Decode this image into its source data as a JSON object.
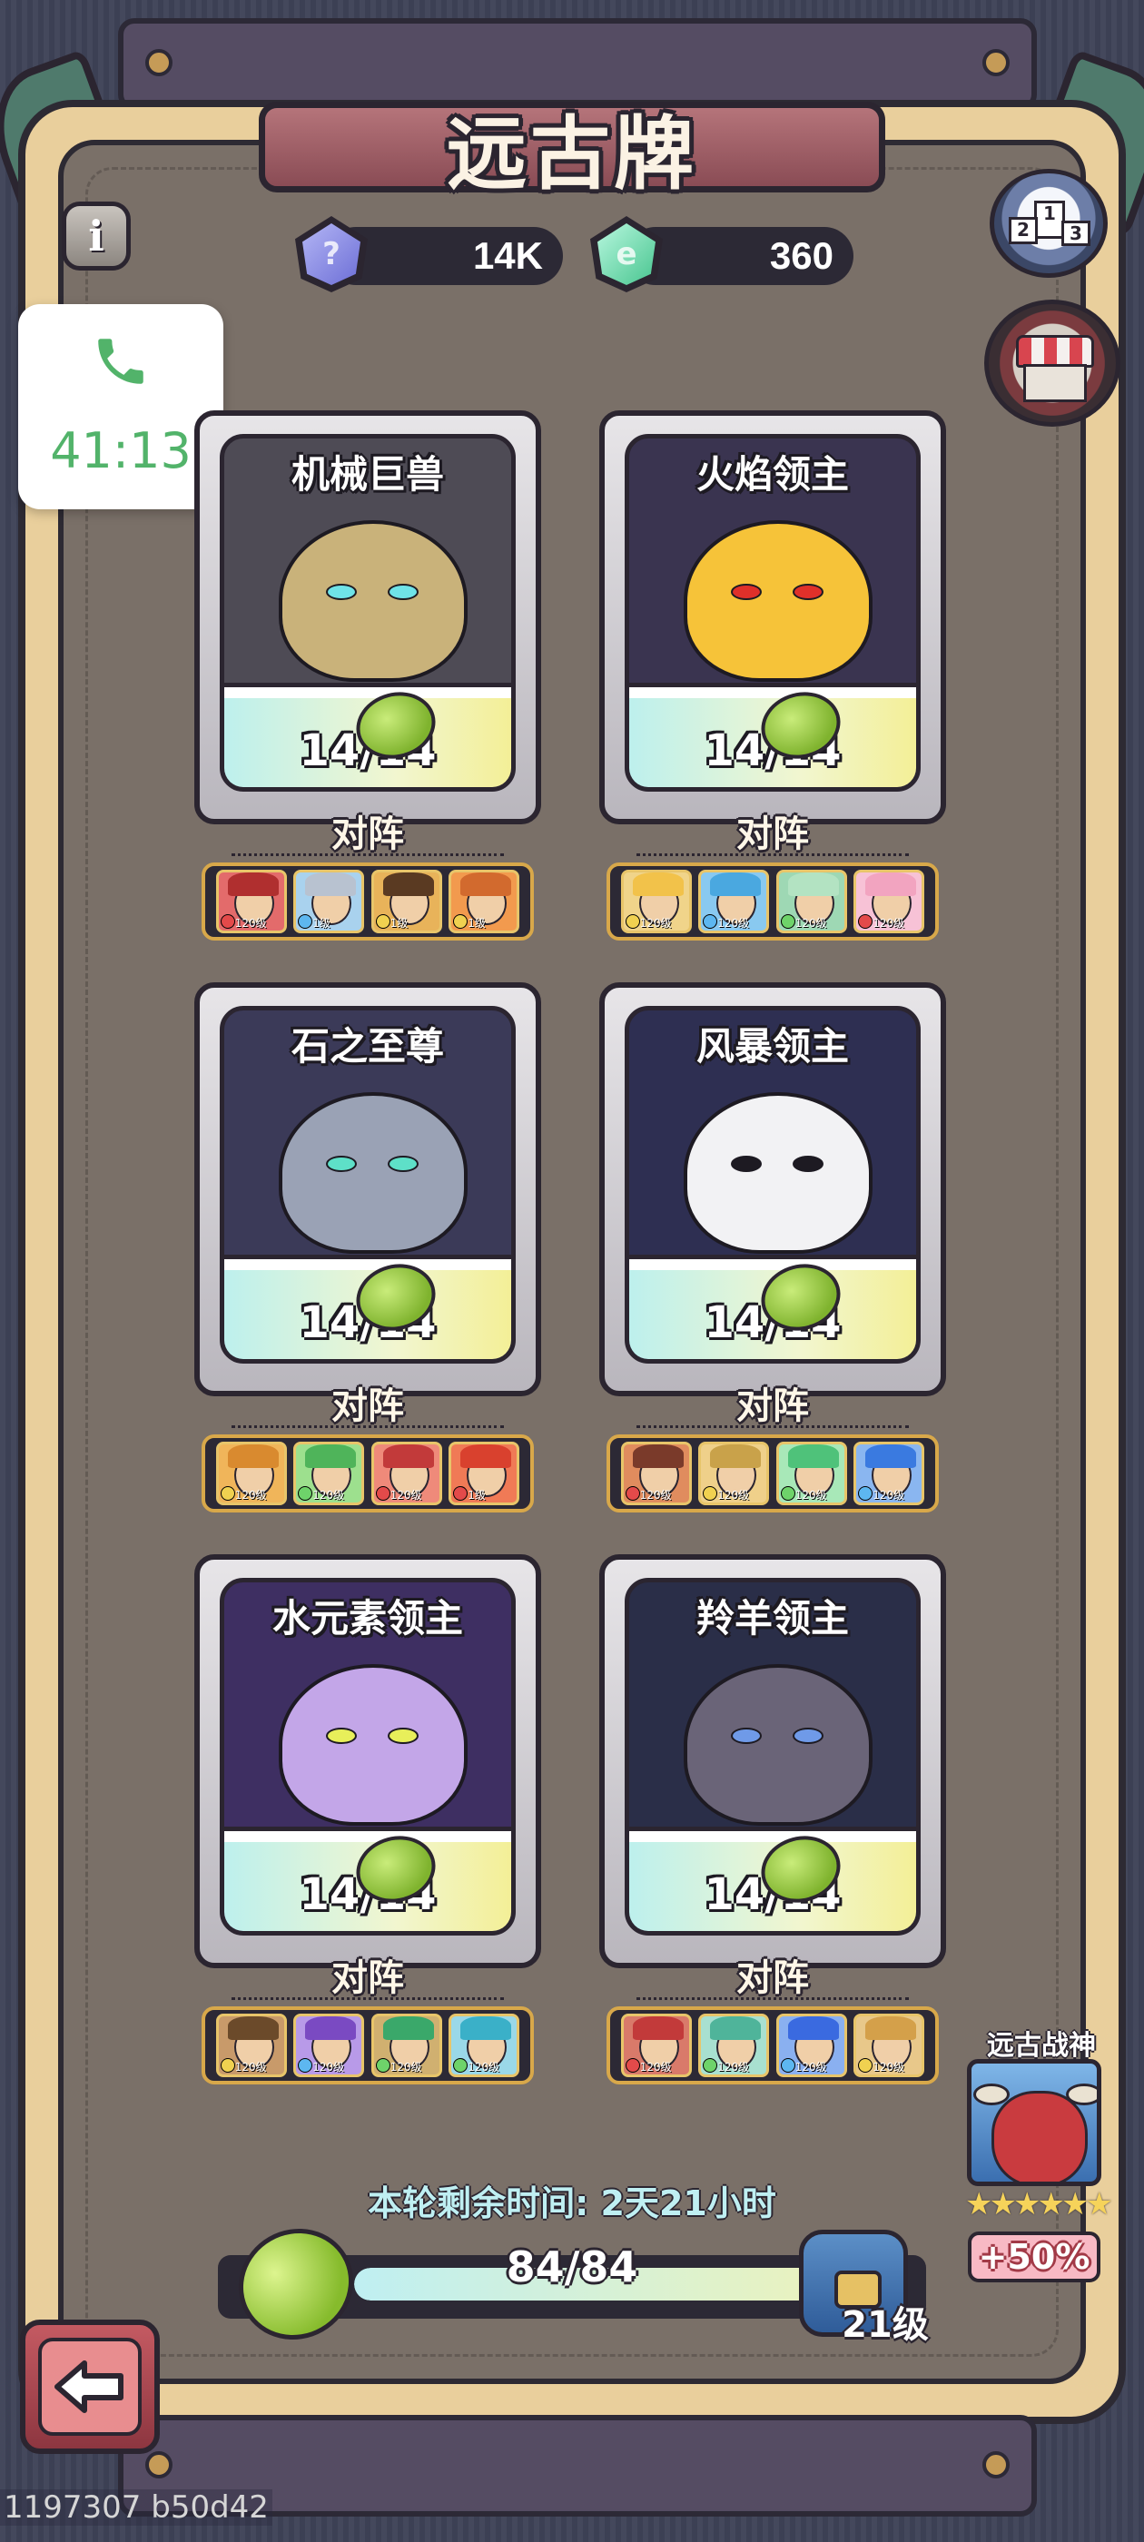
{
  "title": "远古牌",
  "currency": [
    {
      "name": "blue-crystal",
      "value": "14K",
      "color": "#8b8ee0"
    },
    {
      "name": "green-crystal",
      "value": "360",
      "color": "#6fe0b0"
    }
  ],
  "call": {
    "time": "41:13"
  },
  "vs_label": "对阵",
  "cards": [
    {
      "name": "机械巨兽",
      "count": "14/14",
      "bg": "#4e4b55",
      "face": "#c9b27a",
      "eye": "#6fe3e8",
      "team": [
        {
          "hair": "#b02f2f",
          "bg": "#e36b6b",
          "lvl": "120级",
          "el": "#e34a4a"
        },
        {
          "hair": "#b8c2d0",
          "bg": "#a9d2ee",
          "lvl": "1级",
          "el": "#5db7f0"
        },
        {
          "hair": "#5a3a22",
          "bg": "#e8b35a",
          "lvl": "1级",
          "el": "#f0d150"
        },
        {
          "hair": "#d26a2e",
          "bg": "#f29a4e",
          "lvl": "1级",
          "el": "#f0d150"
        }
      ]
    },
    {
      "name": "火焰领主",
      "count": "14/14",
      "bg": "#3a3450",
      "face": "#f6c339",
      "eye": "#e0302a",
      "team": [
        {
          "hair": "#f2c24a",
          "bg": "#f0d48a",
          "lvl": "120级",
          "el": "#f0d150"
        },
        {
          "hair": "#4aa8e0",
          "bg": "#89c9f0",
          "lvl": "120级",
          "el": "#5db7f0"
        },
        {
          "hair": "#b3e3c2",
          "bg": "#9ed8b4",
          "lvl": "120级",
          "el": "#6ed36a"
        },
        {
          "hair": "#f2a4c0",
          "bg": "#f7c2d6",
          "lvl": "120级",
          "el": "#e34a4a"
        }
      ]
    },
    {
      "name": "石之至尊",
      "count": "14/14",
      "bg": "#3b3a58",
      "face": "#9aa2b5",
      "eye": "#5ee0c8",
      "team": [
        {
          "hair": "#d98a2f",
          "bg": "#f0b55a",
          "lvl": "120级",
          "el": "#f0d150"
        },
        {
          "hair": "#4fb45a",
          "bg": "#9de08e",
          "lvl": "120级",
          "el": "#6ed36a"
        },
        {
          "hair": "#c23a3a",
          "bg": "#ef8a7a",
          "lvl": "120级",
          "el": "#e34a4a"
        },
        {
          "hair": "#d9412e",
          "bg": "#f07a56",
          "lvl": "1级",
          "el": "#e34a4a"
        }
      ]
    },
    {
      "name": "风暴领主",
      "count": "14/14",
      "bg": "#2e2f52",
      "face": "#f2f2f4",
      "eye": "#1d1a22",
      "team": [
        {
          "hair": "#7a3a2a",
          "bg": "#e08c5e",
          "lvl": "120级",
          "el": "#e34a4a"
        },
        {
          "hair": "#c9a24a",
          "bg": "#efd08a",
          "lvl": "120级",
          "el": "#f0d150"
        },
        {
          "hair": "#4fc27a",
          "bg": "#a8e8b8",
          "lvl": "120级",
          "el": "#6ed36a"
        },
        {
          "hair": "#3a7ae0",
          "bg": "#8ab6f0",
          "lvl": "120级",
          "el": "#5db7f0"
        }
      ]
    },
    {
      "name": "水元素领主",
      "count": "14/14",
      "bg": "#3e2f62",
      "face": "#c3a6e8",
      "eye": "#e8ef5a",
      "team": [
        {
          "hair": "#6b4a2a",
          "bg": "#c89a6a",
          "lvl": "120级",
          "el": "#f0d150"
        },
        {
          "hair": "#7a4ac2",
          "bg": "#b89ae8",
          "lvl": "120级",
          "el": "#5db7f0"
        },
        {
          "hair": "#3aa86a",
          "bg": "#d0b070",
          "lvl": "120级",
          "el": "#6ed36a"
        },
        {
          "hair": "#3ab0c8",
          "bg": "#9ad8e8",
          "lvl": "120级",
          "el": "#6ed36a"
        }
      ]
    },
    {
      "name": "羚羊领主",
      "count": "14/14",
      "bg": "#2a2e48",
      "face": "#6a6478",
      "eye": "#6f9ae8",
      "team": [
        {
          "hair": "#c23a3a",
          "bg": "#d97a6a",
          "lvl": "120级",
          "el": "#e34a4a"
        },
        {
          "hair": "#4fb49a",
          "bg": "#a8e0d0",
          "lvl": "120级",
          "el": "#6ed36a"
        },
        {
          "hair": "#3a6ae0",
          "bg": "#8ab0f0",
          "lvl": "120级",
          "el": "#5db7f0"
        },
        {
          "hair": "#d4a04a",
          "bg": "#e8c88a",
          "lvl": "120级",
          "el": "#f0d150"
        }
      ]
    }
  ],
  "ancient_god": {
    "title": "远古战神",
    "stars": "★★★★★★",
    "bonus": "+50%"
  },
  "remaining": {
    "label": "本轮剩余时间: ",
    "value": "2天21小时"
  },
  "progress": {
    "text": "84/84",
    "fraction": 1.0
  },
  "chest": {
    "level": "21级"
  },
  "debug": "1197307 b50d42"
}
